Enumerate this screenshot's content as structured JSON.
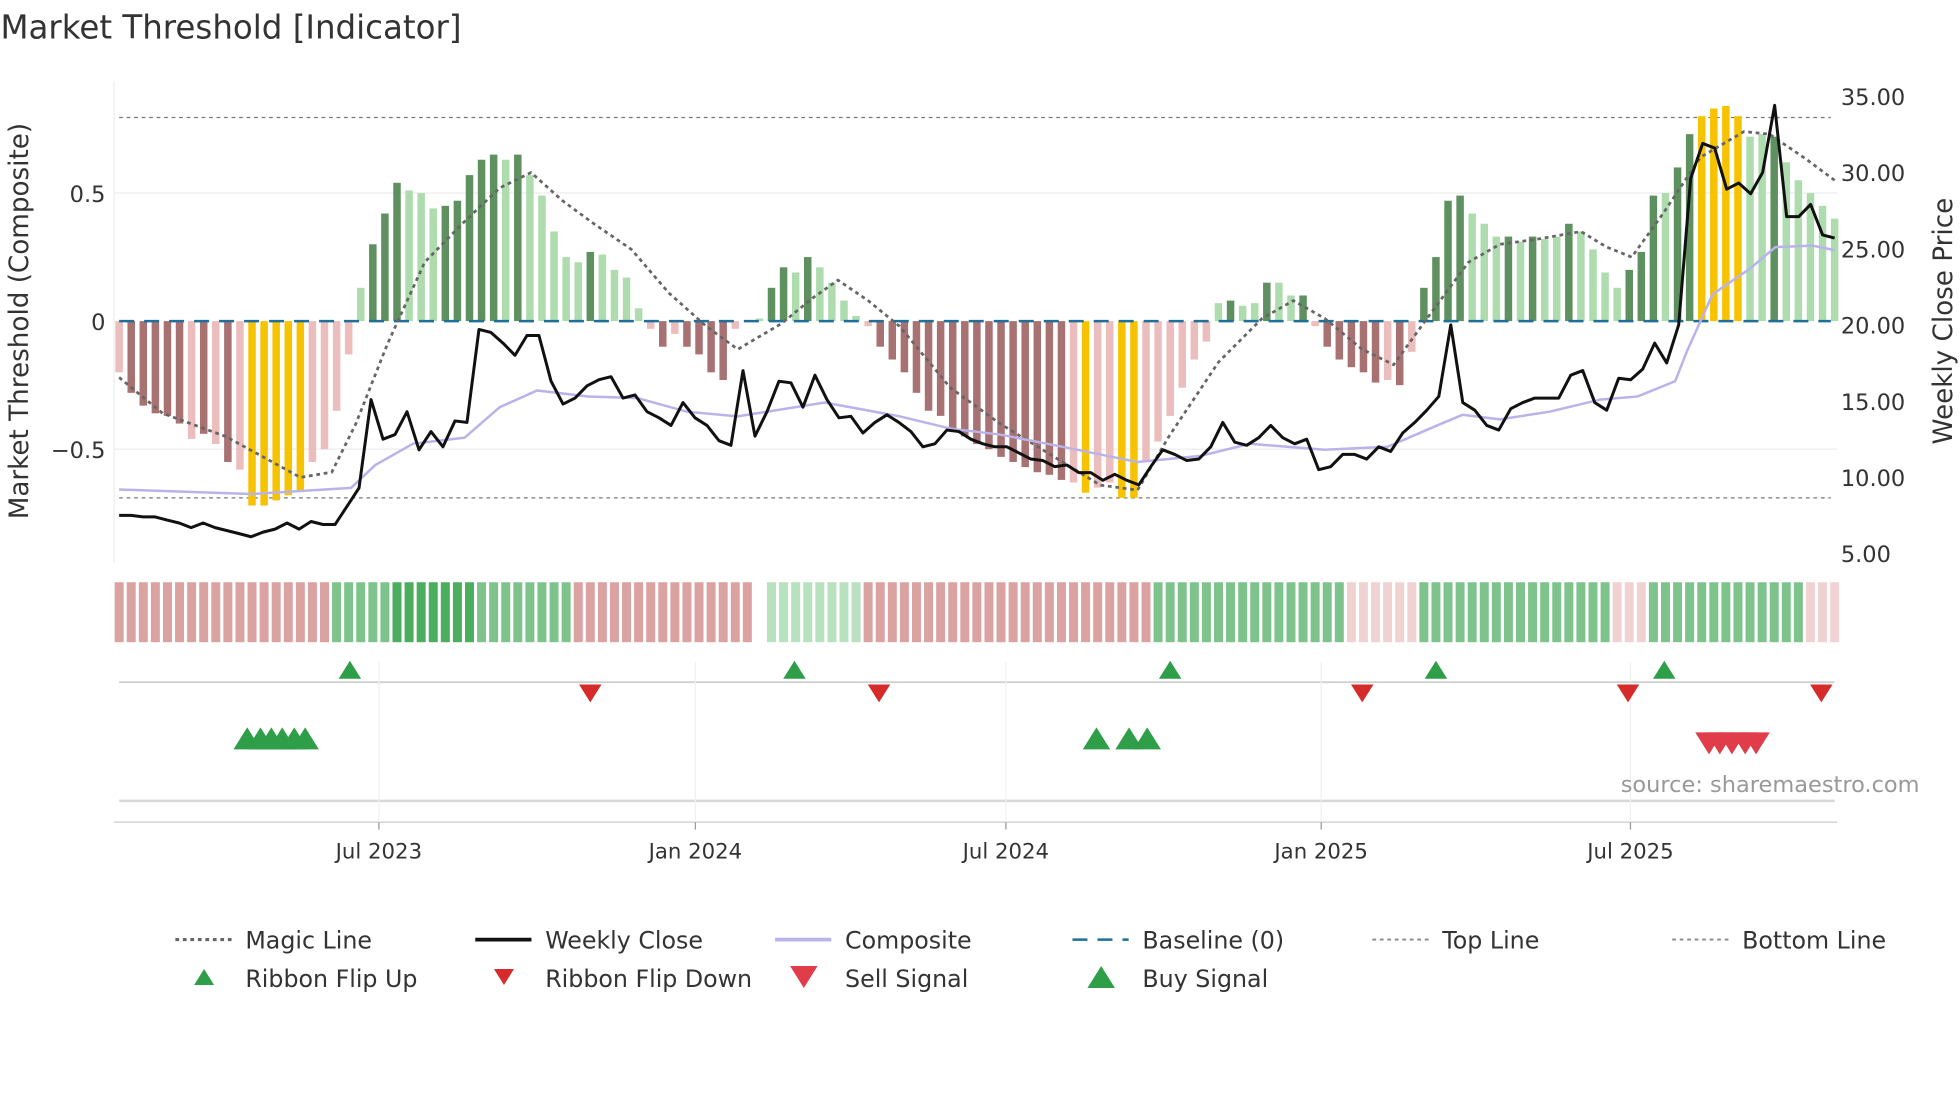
{
  "title": "Market Threshold [Indicator]",
  "source": "source: sharemaestro.com",
  "colors": {
    "DR": "#a87272",
    "LR": "#ecbdbd",
    "Y": "#f7c300",
    "DG": "#5f905f",
    "LG": "#aedcae",
    "ribbon_R": "#dba2a2",
    "ribbon_G": "#7fc38c",
    "ribbon_LG": "#b8e1bf",
    "ribbon_LR": "#f1d2d2",
    "close": "#111111",
    "composite": "#b9b3ea",
    "magic": "#666666",
    "baseline": "#1f6f9a",
    "up": "#2e9e48",
    "down": "#d62b2b",
    "sell": "#e03c4a"
  },
  "chart_data": {
    "type": "bar",
    "title": "Market Threshold [Indicator]",
    "ylabel_left": "Market Threshold (Composite)",
    "ylabel_right": "Weekly Close Price",
    "ylim_left": [
      -0.94,
      0.94
    ],
    "ylim_right": [
      3.5,
      38
    ],
    "left_ticks": [
      {
        "v": 0.5,
        "label": "0.5"
      },
      {
        "v": 0,
        "label": "0"
      },
      {
        "v": -0.5,
        "label": "−0.5"
      }
    ],
    "right_ticks": [
      {
        "v": 35,
        "label": "35.00"
      },
      {
        "v": 30,
        "label": "30.00"
      },
      {
        "v": 25,
        "label": "25.00"
      },
      {
        "v": 20,
        "label": "20.00"
      },
      {
        "v": 15,
        "label": "15.00"
      },
      {
        "v": 10,
        "label": "10.00"
      },
      {
        "v": 5,
        "label": "5.00"
      }
    ],
    "x_ticks": [
      {
        "week": 21.5,
        "label": "Jul 2023"
      },
      {
        "week": 47.7,
        "label": "Jan 2024"
      },
      {
        "week": 73.4,
        "label": "Jul 2024"
      },
      {
        "week": 99.5,
        "label": "Jan 2025"
      },
      {
        "week": 125.1,
        "label": "Jul 2025"
      }
    ],
    "top_line": 0.795,
    "bottom_line": -0.69,
    "baseline": 0,
    "bars": [
      [
        -0.2,
        "LR"
      ],
      [
        -0.28,
        "DR"
      ],
      [
        -0.33,
        "DR"
      ],
      [
        -0.36,
        "DR"
      ],
      [
        -0.37,
        "DR"
      ],
      [
        -0.4,
        "DR"
      ],
      [
        -0.46,
        "LR"
      ],
      [
        -0.44,
        "DR"
      ],
      [
        -0.48,
        "LR"
      ],
      [
        -0.55,
        "DR"
      ],
      [
        -0.58,
        "LR"
      ],
      [
        -0.72,
        "Y"
      ],
      [
        -0.72,
        "Y"
      ],
      [
        -0.7,
        "Y"
      ],
      [
        -0.68,
        "Y"
      ],
      [
        -0.66,
        "Y"
      ],
      [
        -0.55,
        "LR"
      ],
      [
        -0.5,
        "LR"
      ],
      [
        -0.35,
        "LR"
      ],
      [
        -0.13,
        "LR"
      ],
      [
        0.13,
        "LG"
      ],
      [
        0.3,
        "DG"
      ],
      [
        0.42,
        "DG"
      ],
      [
        0.54,
        "DG"
      ],
      [
        0.51,
        "LG"
      ],
      [
        0.5,
        "LG"
      ],
      [
        0.44,
        "LG"
      ],
      [
        0.45,
        "DG"
      ],
      [
        0.47,
        "DG"
      ],
      [
        0.57,
        "DG"
      ],
      [
        0.63,
        "DG"
      ],
      [
        0.65,
        "DG"
      ],
      [
        0.63,
        "LG"
      ],
      [
        0.65,
        "DG"
      ],
      [
        0.57,
        "LG"
      ],
      [
        0.49,
        "LG"
      ],
      [
        0.35,
        "LG"
      ],
      [
        0.25,
        "LG"
      ],
      [
        0.23,
        "LG"
      ],
      [
        0.27,
        "DG"
      ],
      [
        0.26,
        "LG"
      ],
      [
        0.2,
        "LG"
      ],
      [
        0.17,
        "LG"
      ],
      [
        0.05,
        "LG"
      ],
      [
        -0.03,
        "LR"
      ],
      [
        -0.1,
        "DR"
      ],
      [
        -0.05,
        "LR"
      ],
      [
        -0.1,
        "DR"
      ],
      [
        -0.13,
        "DR"
      ],
      [
        -0.2,
        "DR"
      ],
      [
        -0.23,
        "DR"
      ],
      [
        -0.03,
        "LR"
      ],
      [
        0,
        "LG"
      ],
      [
        0.01,
        "LG"
      ],
      [
        0.13,
        "DG"
      ],
      [
        0.21,
        "DG"
      ],
      [
        0.19,
        "LG"
      ],
      [
        0.25,
        "DG"
      ],
      [
        0.21,
        "LG"
      ],
      [
        0.15,
        "LG"
      ],
      [
        0.08,
        "LG"
      ],
      [
        0.02,
        "LG"
      ],
      [
        -0.02,
        "LR"
      ],
      [
        -0.1,
        "DR"
      ],
      [
        -0.15,
        "DR"
      ],
      [
        -0.2,
        "DR"
      ],
      [
        -0.28,
        "DR"
      ],
      [
        -0.35,
        "DR"
      ],
      [
        -0.37,
        "DR"
      ],
      [
        -0.42,
        "DR"
      ],
      [
        -0.45,
        "DR"
      ],
      [
        -0.48,
        "DR"
      ],
      [
        -0.5,
        "DR"
      ],
      [
        -0.53,
        "DR"
      ],
      [
        -0.55,
        "DR"
      ],
      [
        -0.57,
        "DR"
      ],
      [
        -0.59,
        "DR"
      ],
      [
        -0.6,
        "DR"
      ],
      [
        -0.62,
        "DR"
      ],
      [
        -0.63,
        "LR"
      ],
      [
        -0.67,
        "Y"
      ],
      [
        -0.65,
        "LR"
      ],
      [
        -0.63,
        "LR"
      ],
      [
        -0.69,
        "Y"
      ],
      [
        -0.69,
        "Y"
      ],
      [
        -0.55,
        "LR"
      ],
      [
        -0.47,
        "LR"
      ],
      [
        -0.37,
        "LR"
      ],
      [
        -0.26,
        "LR"
      ],
      [
        -0.15,
        "LR"
      ],
      [
        -0.08,
        "LR"
      ],
      [
        0.07,
        "LG"
      ],
      [
        0.08,
        "DG"
      ],
      [
        0.06,
        "LG"
      ],
      [
        0.07,
        "LG"
      ],
      [
        0.15,
        "DG"
      ],
      [
        0.15,
        "LG"
      ],
      [
        0.1,
        "LG"
      ],
      [
        0.1,
        "DG"
      ],
      [
        -0.02,
        "LR"
      ],
      [
        -0.1,
        "DR"
      ],
      [
        -0.15,
        "DR"
      ],
      [
        -0.18,
        "DR"
      ],
      [
        -0.2,
        "DR"
      ],
      [
        -0.24,
        "DR"
      ],
      [
        -0.23,
        "LR"
      ],
      [
        -0.25,
        "DR"
      ],
      [
        -0.12,
        "LR"
      ],
      [
        0.13,
        "DG"
      ],
      [
        0.25,
        "DG"
      ],
      [
        0.47,
        "DG"
      ],
      [
        0.49,
        "DG"
      ],
      [
        0.42,
        "LG"
      ],
      [
        0.38,
        "LG"
      ],
      [
        0.33,
        "LG"
      ],
      [
        0.33,
        "DG"
      ],
      [
        0.31,
        "LG"
      ],
      [
        0.33,
        "DG"
      ],
      [
        0.32,
        "LG"
      ],
      [
        0.33,
        "LG"
      ],
      [
        0.38,
        "DG"
      ],
      [
        0.35,
        "LG"
      ],
      [
        0.28,
        "LG"
      ],
      [
        0.19,
        "LG"
      ],
      [
        0.13,
        "LG"
      ],
      [
        0.2,
        "DG"
      ],
      [
        0.27,
        "DG"
      ],
      [
        0.49,
        "DG"
      ],
      [
        0.5,
        "LG"
      ],
      [
        0.6,
        "DG"
      ],
      [
        0.73,
        "DG"
      ],
      [
        0.8,
        "Y"
      ],
      [
        0.83,
        "Y"
      ],
      [
        0.84,
        "Y"
      ],
      [
        0.8,
        "Y"
      ],
      [
        0.72,
        "LG"
      ],
      [
        0.73,
        "LG"
      ],
      [
        0.72,
        "DG"
      ],
      [
        0.62,
        "LG"
      ],
      [
        0.55,
        "LG"
      ],
      [
        0.5,
        "LG"
      ],
      [
        0.45,
        "LG"
      ],
      [
        0.4,
        "LG"
      ]
    ],
    "weekly_close": [
      7.5,
      7.5,
      7.4,
      7.4,
      7.2,
      7.0,
      6.7,
      7.0,
      6.7,
      6.5,
      6.3,
      6.1,
      6.4,
      6.6,
      7.0,
      6.6,
      7.1,
      6.9,
      6.9,
      8.1,
      9.3,
      15.1,
      12.5,
      12.8,
      14.3,
      11.8,
      13.0,
      12.0,
      13.7,
      13.6,
      19.7,
      19.5,
      18.8,
      18.0,
      19.3,
      19.3,
      16.3,
      14.8,
      15.2,
      16.0,
      16.4,
      16.6,
      15.2,
      15.4,
      14.3,
      13.9,
      13.4,
      14.9,
      13.9,
      13.4,
      12.4,
      12.1,
      17.0,
      12.7,
      14.3,
      16.3,
      16.2,
      14.6,
      16.7,
      15.1,
      13.9,
      14.0,
      12.9,
      13.6,
      14.1,
      13.6,
      13.0,
      12.0,
      12.2,
      13.1,
      13.0,
      12.5,
      12.2,
      12.0,
      12.0,
      11.6,
      11.2,
      11.1,
      10.7,
      10.8,
      10.3,
      10.3,
      9.8,
      10.2,
      9.8,
      9.5,
      10.7,
      11.8,
      11.5,
      11.1,
      11.2,
      12.0,
      13.6,
      12.3,
      12.1,
      12.6,
      13.4,
      12.6,
      12.2,
      12.5,
      10.5,
      10.7,
      11.5,
      11.5,
      11.2,
      12.0,
      11.7,
      12.9,
      13.6,
      14.4,
      15.3,
      20.0,
      14.9,
      14.4,
      13.4,
      13.1,
      14.5,
      14.9,
      15.2,
      15.2,
      15.2,
      16.7,
      17.0,
      14.9,
      14.4,
      16.5,
      16.4,
      17.1,
      18.8,
      17.5,
      20.0,
      29.6,
      31.9,
      31.6,
      28.9,
      29.3,
      28.6,
      30.0,
      34.4,
      27.1,
      27.1,
      27.9,
      25.9,
      25.7
    ],
    "composite_line": [
      [
        0,
        9.2
      ],
      [
        10.9,
        8.9
      ],
      [
        19.2,
        9.3
      ],
      [
        21.2,
        10.8
      ],
      [
        24.3,
        12.2
      ],
      [
        28.6,
        12.6
      ],
      [
        31.5,
        14.6
      ],
      [
        34.6,
        15.7
      ],
      [
        38.8,
        15.3
      ],
      [
        42.9,
        15.2
      ],
      [
        47.0,
        14.3
      ],
      [
        51.2,
        14.0
      ],
      [
        58.4,
        14.9
      ],
      [
        64.6,
        14.0
      ],
      [
        68.8,
        13.2
      ],
      [
        72.9,
        12.8
      ],
      [
        78.1,
        12.0
      ],
      [
        84.3,
        11.0
      ],
      [
        89.5,
        11.4
      ],
      [
        93.6,
        12.2
      ],
      [
        99.8,
        11.8
      ],
      [
        105,
        12.0
      ],
      [
        109.1,
        13.4
      ],
      [
        111.2,
        14.1
      ],
      [
        114.3,
        13.8
      ],
      [
        118.4,
        14.3
      ],
      [
        122.6,
        15.1
      ],
      [
        125.7,
        15.3
      ],
      [
        128.8,
        16.3
      ],
      [
        129.8,
        18.3
      ],
      [
        131.9,
        22.0
      ],
      [
        135,
        23.7
      ],
      [
        137.1,
        25.1
      ],
      [
        140.2,
        25.2
      ],
      [
        142,
        24.9
      ]
    ],
    "magic_line": [
      [
        0,
        -0.22
      ],
      [
        3.6,
        -0.36
      ],
      [
        8.8,
        -0.45
      ],
      [
        11.9,
        -0.53
      ],
      [
        15,
        -0.61
      ],
      [
        17.6,
        -0.59
      ],
      [
        19.6,
        -0.4
      ],
      [
        22.2,
        -0.09
      ],
      [
        25.3,
        0.23
      ],
      [
        28.4,
        0.38
      ],
      [
        31.5,
        0.52
      ],
      [
        34.1,
        0.58
      ],
      [
        36.7,
        0.47
      ],
      [
        39.3,
        0.38
      ],
      [
        42.4,
        0.28
      ],
      [
        45.5,
        0.11
      ],
      [
        48.6,
        -0.02
      ],
      [
        51.2,
        -0.11
      ],
      [
        54.8,
        -0.01
      ],
      [
        57.4,
        0.09
      ],
      [
        59.5,
        0.16
      ],
      [
        62,
        0.08
      ],
      [
        64.6,
        -0.02
      ],
      [
        68.8,
        -0.26
      ],
      [
        72.9,
        -0.4
      ],
      [
        78.1,
        -0.55
      ],
      [
        81.2,
        -0.64
      ],
      [
        84.3,
        -0.66
      ],
      [
        86.9,
        -0.45
      ],
      [
        91,
        -0.16
      ],
      [
        94.6,
        0.01
      ],
      [
        97.2,
        0.08
      ],
      [
        99.8,
        0.01
      ],
      [
        102.9,
        -0.11
      ],
      [
        105.5,
        -0.17
      ],
      [
        108.1,
        0
      ],
      [
        111.7,
        0.23
      ],
      [
        114.3,
        0.3
      ],
      [
        117.4,
        0.32
      ],
      [
        121,
        0.35
      ],
      [
        123.1,
        0.29
      ],
      [
        125.2,
        0.25
      ],
      [
        127.8,
        0.42
      ],
      [
        130.9,
        0.64
      ],
      [
        134.5,
        0.74
      ],
      [
        136.6,
        0.73
      ],
      [
        139.7,
        0.63
      ],
      [
        142,
        0.55
      ]
    ],
    "ribbon_segments": [
      [
        "R",
        18
      ],
      [
        "G",
        20
      ],
      [
        "R",
        15
      ],
      [
        "none",
        1
      ],
      [
        "LG",
        8
      ],
      [
        "R",
        24
      ],
      [
        "G",
        16
      ],
      [
        "LR",
        6
      ],
      [
        "G",
        16
      ],
      [
        "LR",
        3
      ],
      [
        "G",
        13
      ],
      [
        "LR",
        3
      ]
    ],
    "ribbon_flip_up": [
      19.1,
      55.9,
      87.0,
      109.0,
      127.9
    ],
    "ribbon_flip_down": [
      39.0,
      62.9,
      102.9,
      124.9,
      140.9
    ],
    "buy_signals": [
      10.6,
      11.7,
      12.6,
      13.5,
      14.5,
      15.4,
      80.9,
      83.6,
      85.1
    ],
    "sell_signals": [
      131.6,
      132.5,
      133.5,
      134.6,
      135.5
    ],
    "legend": {
      "magic": "Magic Line",
      "close": "Weekly Close",
      "composite": "Composite",
      "baseline": "Baseline (0)",
      "top": "Top Line",
      "bottom": "Bottom Line",
      "flip_up": "Ribbon Flip Up",
      "flip_down": "Ribbon Flip Down",
      "sell": "Sell Signal",
      "buy": "Buy Signal"
    }
  }
}
